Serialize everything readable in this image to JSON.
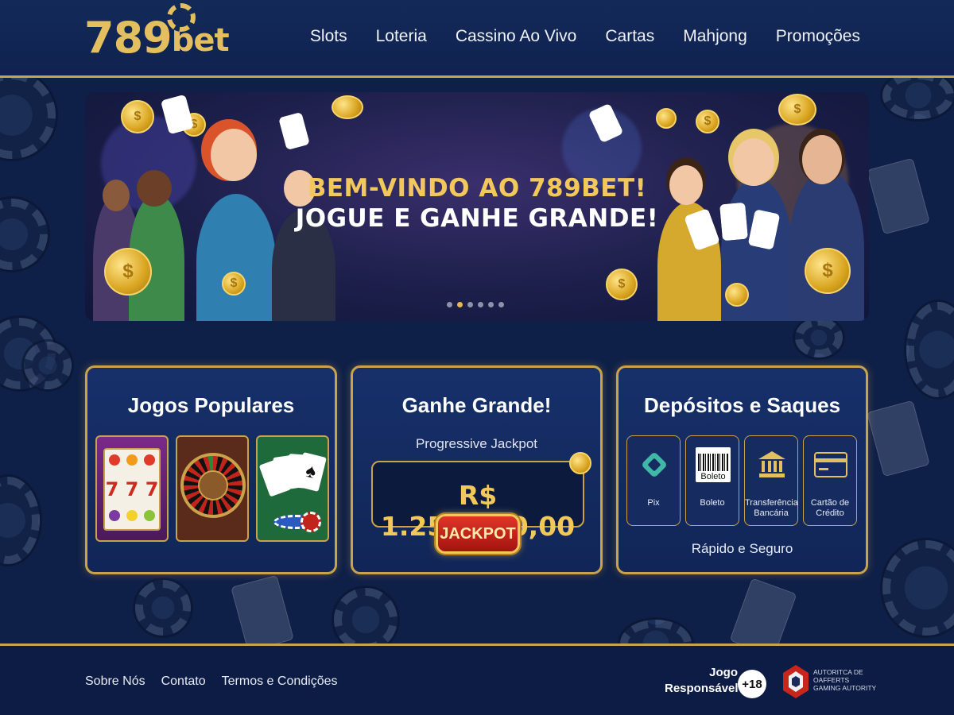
{
  "brand": {
    "logo_number": "789",
    "logo_word": "bet"
  },
  "nav": [
    {
      "label": "Slots"
    },
    {
      "label": "Loteria"
    },
    {
      "label": "Cassino Ao Vivo"
    },
    {
      "label": "Cartas"
    },
    {
      "label": "Mahjong"
    },
    {
      "label": "Promoções"
    }
  ],
  "hero": {
    "title_line1": "BEM-VINDO AO 789BET!",
    "title_line2": "JOGUE E GANHE GRANDE!",
    "slide_count": 6,
    "active_slide": 2
  },
  "panels": {
    "popular": {
      "title": "Jogos Populares",
      "games": [
        {
          "name": "slot-machine"
        },
        {
          "name": "roulette"
        },
        {
          "name": "cards"
        }
      ],
      "slot_reel": "7 7 7"
    },
    "jackpot": {
      "title": "Ganhe Grande!",
      "subtitle": "Progressive Jackpot",
      "value": "R$ 1.250.000,00",
      "badge": "JACKPOT"
    },
    "payments": {
      "title": "Depósitos e Saques",
      "methods": [
        {
          "label": "Pix",
          "icon": "pix-icon"
        },
        {
          "label": "Boleto",
          "icon": "barcode-icon",
          "icon_text": "Boleto"
        },
        {
          "label": "Transferência Bancária",
          "icon": "bank-icon"
        },
        {
          "label": "Cartão de Crédito",
          "icon": "credit-card-icon"
        }
      ],
      "footer_text": "Rápido e Seguro"
    }
  },
  "footer": {
    "links": [
      {
        "label": "Sobre Nós"
      },
      {
        "label": "Contato"
      },
      {
        "label": "Termos e Condições"
      }
    ],
    "responsible_line1": "Jogo",
    "responsible_line2": "Responsável",
    "age_badge": "+18",
    "authority_text": "AUTORITCA DE OAFFERTS GAMING AUTORITY"
  },
  "colors": {
    "background": "#0f2048",
    "gold": "#c9a24a",
    "gold_text": "#f2c85a",
    "jackpot_red": "#c8261c"
  }
}
